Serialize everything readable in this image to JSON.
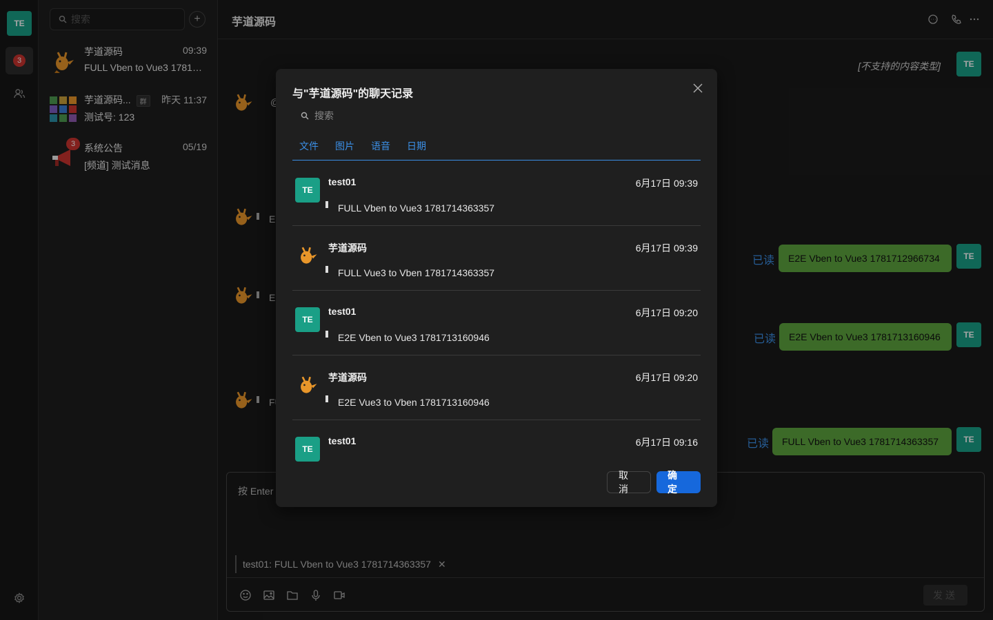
{
  "rail": {
    "me_initials": "TE",
    "chat_badge": "3"
  },
  "conv_list": {
    "search_placeholder": "搜索",
    "add_label": "+",
    "items": [
      {
        "name": "芋道源码",
        "time": "09:39",
        "message": "FULL Vben to Vue3 1781714363357"
      },
      {
        "name": "芋道源码...",
        "tag": "群",
        "time": "昨天 11:37",
        "message": "测试号: 123"
      },
      {
        "name": "系统公告",
        "time": "05/19",
        "message": "[频道] 测试消息",
        "badge": "3"
      }
    ]
  },
  "chat": {
    "title": "芋道源码",
    "unsupported": "[不支持的内容类型]",
    "my_initials": "TE",
    "left_fragments": [
      "@",
      "E:",
      "E:",
      "FU"
    ],
    "messages": [
      {
        "read": "已读",
        "text": "E2E Vben to Vue3 1781712966734"
      },
      {
        "read": "已读",
        "text": "E2E Vben to Vue3 1781713160946"
      },
      {
        "read": "已读",
        "text": "FULL Vben to Vue3 1781714363357"
      }
    ],
    "composer": {
      "placeholder": "按 Enter",
      "quote_sender": "test01:",
      "quote_text": "FULL Vben to Vue3 1781714363357",
      "quote_close": "✕",
      "send_label": "发送"
    }
  },
  "modal": {
    "title": "与\"芋道源码\"的聊天记录",
    "search_placeholder": "搜索",
    "tabs": [
      "文件",
      "图片",
      "语音",
      "日期"
    ],
    "records": [
      {
        "sender": "test01",
        "initials": "TE",
        "time": "6月17日 09:39",
        "text": "FULL Vben to Vue3 1781714363357"
      },
      {
        "sender": "芋道源码",
        "initials": "",
        "time": "6月17日 09:39",
        "text": "FULL Vue3 to Vben 1781714363357"
      },
      {
        "sender": "test01",
        "initials": "TE",
        "time": "6月17日 09:20",
        "text": "E2E Vben to Vue3 1781713160946"
      },
      {
        "sender": "芋道源码",
        "initials": "",
        "time": "6月17日 09:20",
        "text": "E2E Vue3 to Vben 1781713160946"
      },
      {
        "sender": "test01",
        "initials": "TE",
        "time": "6月17日 09:16",
        "text": ""
      }
    ],
    "cancel_label": "取消",
    "ok_label": "确定"
  },
  "colors": {
    "accent": "#1668dc",
    "avatar": "#1a9f86",
    "bubble": "#5ca33e",
    "read": "#3b8fe6",
    "badge": "#c9342f"
  }
}
